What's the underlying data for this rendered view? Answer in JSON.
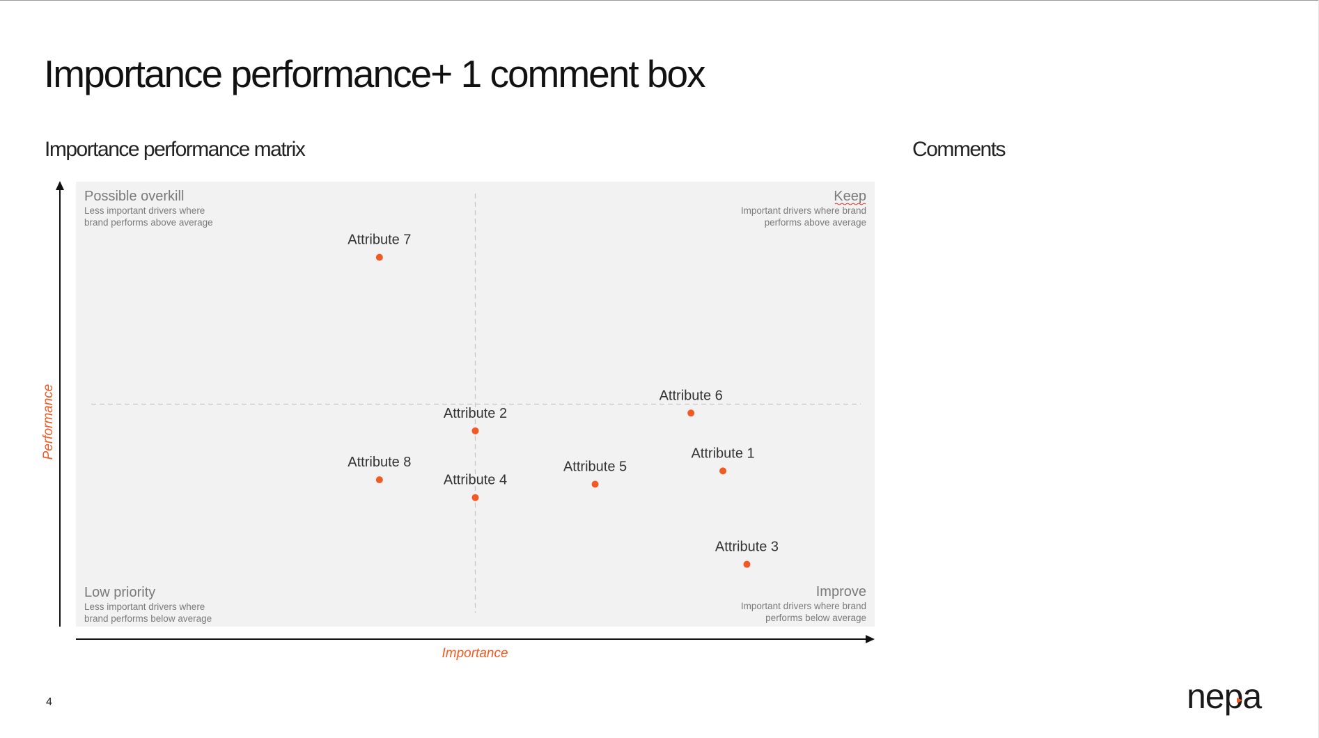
{
  "slide": {
    "title": "Importance performance+ 1 comment box",
    "page_number": "4",
    "logo_text": "nepa"
  },
  "left_panel": {
    "heading": "Importance performance matrix"
  },
  "right_panel": {
    "heading": "Comments"
  },
  "colors": {
    "accent": "#f15a22",
    "plot_background": "#f2f2f2",
    "quadrant_text": "#7a7a7a",
    "axis": "#111111"
  },
  "chart_data": {
    "type": "scatter",
    "xlabel": "Importance",
    "ylabel": "Performance",
    "quadrants": [
      {
        "position": "top-left",
        "name": "Possible overkill",
        "description": [
          "Less important drivers where",
          "brand performs above average"
        ]
      },
      {
        "position": "top-right",
        "name": "Keep",
        "description": [
          "Important drivers where brand",
          "performs above average"
        ]
      },
      {
        "position": "bottom-left",
        "name": "Low priority",
        "description": [
          "Less important drivers where",
          "brand performs below average"
        ]
      },
      {
        "position": "bottom-right",
        "name": "Improve",
        "description": [
          "Important drivers where brand",
          "performs below average"
        ]
      }
    ],
    "xlim": [
      0,
      100
    ],
    "ylim": [
      0,
      100
    ],
    "divider": {
      "x": 50,
      "y": 50
    },
    "points": [
      {
        "label": "Attribute 1",
        "x": 81,
        "y": 35
      },
      {
        "label": "Attribute 2",
        "x": 50,
        "y": 44
      },
      {
        "label": "Attribute 3",
        "x": 84,
        "y": 14
      },
      {
        "label": "Attribute 4",
        "x": 50,
        "y": 29
      },
      {
        "label": "Attribute 5",
        "x": 65,
        "y": 32
      },
      {
        "label": "Attribute 6",
        "x": 77,
        "y": 48
      },
      {
        "label": "Attribute 7",
        "x": 38,
        "y": 83
      },
      {
        "label": "Attribute 8",
        "x": 38,
        "y": 33
      }
    ]
  }
}
